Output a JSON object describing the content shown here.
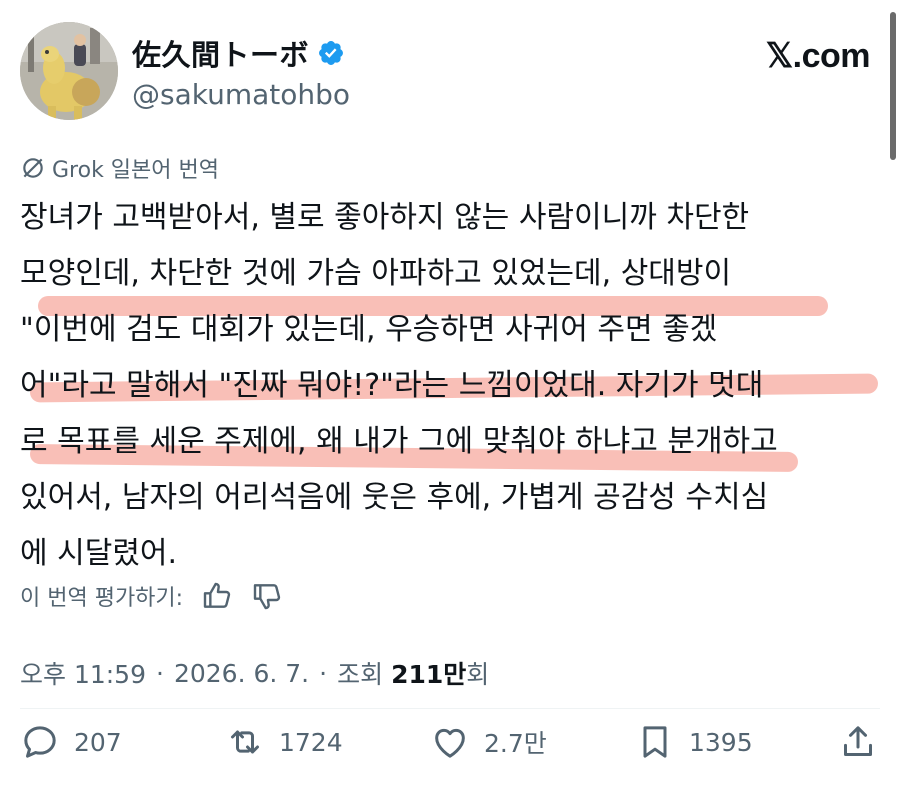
{
  "header": {
    "display_name": "佐久間トーボ",
    "handle": "@sakumatohbo",
    "source_label": "𝕏.com"
  },
  "translation": {
    "label": "Grok 일본어 번역"
  },
  "tweet": {
    "lines": [
      "장녀가 고백받아서, 별로 좋아하지 않는 사람이니까 차단한",
      "모양인데, 차단한 것에 가슴 아파하고 있었는데, 상대방이",
      "\"이번에 검도 대회가 있는데, 우승하면 사귀어 주면 좋겠",
      "어\"라고 말해서 \"진짜 뭐야!?\"라는 느낌이었대. 자기가 멋대",
      "로 목표를 세운 주제에, 왜 내가 그에 맞춰야 하냐고 분개하고",
      "있어서, 남자의 어리석음에 웃은 후에, 가볍게 공감성 수치심",
      "에 시달렸어."
    ]
  },
  "rating": {
    "label": "이 번역 평가하기:"
  },
  "meta": {
    "time": "오후 11:59",
    "date": "2026. 6. 7.",
    "views_label": "조회",
    "views_count": "211",
    "views_unit": "만",
    "views_suffix": "회"
  },
  "actions": {
    "replies": "207",
    "reposts": "1724",
    "likes": "2.7만",
    "bookmarks": "1395"
  },
  "colors": {
    "text": "#0f1419",
    "secondary": "#536471",
    "verified": "#1d9bf0",
    "highlight": "#f27060"
  }
}
